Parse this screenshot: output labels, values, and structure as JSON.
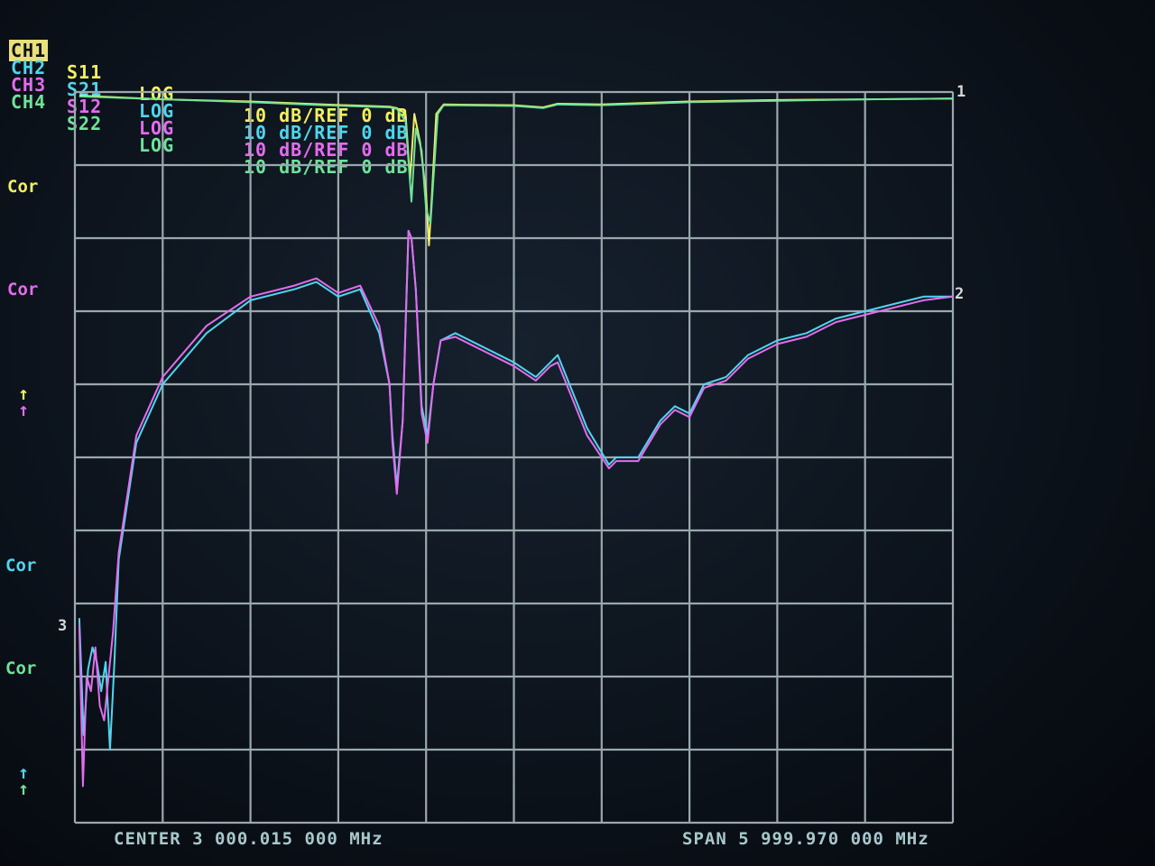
{
  "channels": [
    {
      "id": "CH1",
      "param": "S11",
      "format": "LOG",
      "scale": "10 dB/REF 0 dB",
      "color": "#f4ef62",
      "active": true
    },
    {
      "id": "CH2",
      "param": "S21",
      "format": "LOG",
      "scale": "10 dB/REF 0 dB",
      "color": "#4fd6ee",
      "active": false
    },
    {
      "id": "CH3",
      "param": "S12",
      "format": "LOG",
      "scale": "10 dB/REF 0 dB",
      "color": "#e46cf0",
      "active": false
    },
    {
      "id": "CH4",
      "param": "S22",
      "format": "LOG",
      "scale": "10 dB/REF 0 dB",
      "color": "#6ee39a",
      "active": false
    }
  ],
  "side_labels": [
    {
      "text": "Cor",
      "color": "#f4ef62"
    },
    {
      "text": "Cor",
      "color": "#e46cf0"
    },
    {
      "text": "Cor",
      "color": "#4fd6ee"
    },
    {
      "text": "Cor",
      "color": "#6ee39a"
    }
  ],
  "ref_arrows": [
    {
      "glyph": "↑",
      "color": "#f4ef62"
    },
    {
      "glyph": "↑",
      "color": "#e46cf0"
    },
    {
      "glyph": "↑",
      "color": "#4fd6ee"
    },
    {
      "glyph": "↑",
      "color": "#6ee39a"
    }
  ],
  "markers": {
    "m1": "1",
    "m2": "2",
    "m3": "3"
  },
  "footer": {
    "center": "CENTER 3 000.015 000 MHz",
    "span": "SPAN 5 999.970 000 MHz"
  },
  "grid": {
    "divisions_x": 10,
    "divisions_y": 10,
    "color": "#9aa8ae"
  },
  "chart_data": {
    "type": "line",
    "xlabel": "",
    "ylabel": "",
    "center_mhz": 3000.015,
    "span_mhz": 5999.97,
    "ylim": [
      -100,
      0
    ],
    "x_unit": "MHz",
    "y_unit": "dB",
    "series": [
      {
        "name": "S11",
        "color": "#f4ef62",
        "points": [
          [
            30,
            -0.5
          ],
          [
            600,
            -1
          ],
          [
            1200,
            -1.3
          ],
          [
            1700,
            -1.7
          ],
          [
            2150,
            -2
          ],
          [
            2200,
            -2.2
          ],
          [
            2260,
            -3
          ],
          [
            2290,
            -12
          ],
          [
            2320,
            -3
          ],
          [
            2360,
            -7
          ],
          [
            2400,
            -14
          ],
          [
            2420,
            -21
          ],
          [
            2440,
            -14
          ],
          [
            2470,
            -3
          ],
          [
            2520,
            -1.7
          ],
          [
            3000,
            -1.8
          ],
          [
            3200,
            -2.1
          ],
          [
            3300,
            -1.6
          ],
          [
            3600,
            -1.7
          ],
          [
            4200,
            -1.3
          ],
          [
            4800,
            -1.1
          ],
          [
            5400,
            -1
          ],
          [
            6000,
            -0.9
          ]
        ]
      },
      {
        "name": "S22",
        "color": "#6ee39a",
        "points": [
          [
            30,
            -0.6
          ],
          [
            600,
            -1
          ],
          [
            1200,
            -1.4
          ],
          [
            1700,
            -1.8
          ],
          [
            2150,
            -2.1
          ],
          [
            2200,
            -2.3
          ],
          [
            2260,
            -4
          ],
          [
            2300,
            -15
          ],
          [
            2330,
            -5
          ],
          [
            2370,
            -8
          ],
          [
            2400,
            -16
          ],
          [
            2430,
            -18
          ],
          [
            2450,
            -12
          ],
          [
            2480,
            -3
          ],
          [
            2520,
            -1.8
          ],
          [
            3000,
            -1.9
          ],
          [
            3200,
            -2.2
          ],
          [
            3300,
            -1.7
          ],
          [
            3600,
            -1.8
          ],
          [
            4200,
            -1.4
          ],
          [
            4800,
            -1.2
          ],
          [
            5400,
            -1
          ],
          [
            6000,
            -0.9
          ]
        ]
      },
      {
        "name": "S21",
        "color": "#4fd6ee",
        "points": [
          [
            30,
            -72
          ],
          [
            60,
            -88
          ],
          [
            90,
            -79
          ],
          [
            120,
            -76
          ],
          [
            150,
            -78
          ],
          [
            180,
            -82
          ],
          [
            210,
            -78
          ],
          [
            240,
            -90
          ],
          [
            270,
            -78
          ],
          [
            300,
            -64
          ],
          [
            420,
            -48
          ],
          [
            600,
            -40
          ],
          [
            900,
            -33
          ],
          [
            1200,
            -28.5
          ],
          [
            1500,
            -27
          ],
          [
            1650,
            -26
          ],
          [
            1800,
            -28
          ],
          [
            1950,
            -27
          ],
          [
            2080,
            -33
          ],
          [
            2150,
            -40
          ],
          [
            2170,
            -47
          ],
          [
            2200,
            -54
          ],
          [
            2240,
            -45
          ],
          [
            2280,
            -19
          ],
          [
            2300,
            -20
          ],
          [
            2330,
            -27
          ],
          [
            2370,
            -43
          ],
          [
            2410,
            -47
          ],
          [
            2450,
            -40
          ],
          [
            2500,
            -34
          ],
          [
            2600,
            -33
          ],
          [
            2800,
            -35
          ],
          [
            3000,
            -37
          ],
          [
            3150,
            -39
          ],
          [
            3250,
            -37
          ],
          [
            3300,
            -36
          ],
          [
            3400,
            -41
          ],
          [
            3500,
            -46
          ],
          [
            3650,
            -51
          ],
          [
            3700,
            -50
          ],
          [
            3850,
            -50
          ],
          [
            4000,
            -45
          ],
          [
            4100,
            -43
          ],
          [
            4200,
            -44
          ],
          [
            4300,
            -40
          ],
          [
            4450,
            -39
          ],
          [
            4600,
            -36
          ],
          [
            4800,
            -34
          ],
          [
            5000,
            -33
          ],
          [
            5200,
            -31
          ],
          [
            5400,
            -30
          ],
          [
            5600,
            -29
          ],
          [
            5800,
            -28
          ],
          [
            6000,
            -28
          ]
        ]
      },
      {
        "name": "S12",
        "color": "#e46cf0",
        "points": [
          [
            30,
            -73
          ],
          [
            55,
            -95
          ],
          [
            80,
            -80
          ],
          [
            110,
            -82
          ],
          [
            140,
            -76
          ],
          [
            170,
            -84
          ],
          [
            200,
            -86
          ],
          [
            230,
            -80
          ],
          [
            260,
            -74
          ],
          [
            300,
            -63
          ],
          [
            420,
            -47
          ],
          [
            600,
            -39
          ],
          [
            900,
            -32
          ],
          [
            1200,
            -28
          ],
          [
            1500,
            -26.5
          ],
          [
            1650,
            -25.5
          ],
          [
            1800,
            -27.5
          ],
          [
            1950,
            -26.5
          ],
          [
            2080,
            -32
          ],
          [
            2150,
            -40
          ],
          [
            2170,
            -48
          ],
          [
            2200,
            -55
          ],
          [
            2240,
            -45
          ],
          [
            2280,
            -19
          ],
          [
            2300,
            -20
          ],
          [
            2330,
            -27
          ],
          [
            2370,
            -44
          ],
          [
            2410,
            -48
          ],
          [
            2450,
            -40
          ],
          [
            2500,
            -34
          ],
          [
            2600,
            -33.5
          ],
          [
            2800,
            -35.5
          ],
          [
            3000,
            -37.5
          ],
          [
            3150,
            -39.5
          ],
          [
            3250,
            -37.5
          ],
          [
            3300,
            -37
          ],
          [
            3400,
            -42
          ],
          [
            3500,
            -47
          ],
          [
            3650,
            -51.5
          ],
          [
            3700,
            -50.5
          ],
          [
            3850,
            -50.5
          ],
          [
            4000,
            -45.5
          ],
          [
            4100,
            -43.5
          ],
          [
            4200,
            -44.5
          ],
          [
            4300,
            -40.5
          ],
          [
            4450,
            -39.5
          ],
          [
            4600,
            -36.5
          ],
          [
            4800,
            -34.5
          ],
          [
            5000,
            -33.5
          ],
          [
            5200,
            -31.5
          ],
          [
            5400,
            -30.5
          ],
          [
            5600,
            -29.5
          ],
          [
            5800,
            -28.5
          ],
          [
            6000,
            -28
          ]
        ]
      }
    ]
  }
}
